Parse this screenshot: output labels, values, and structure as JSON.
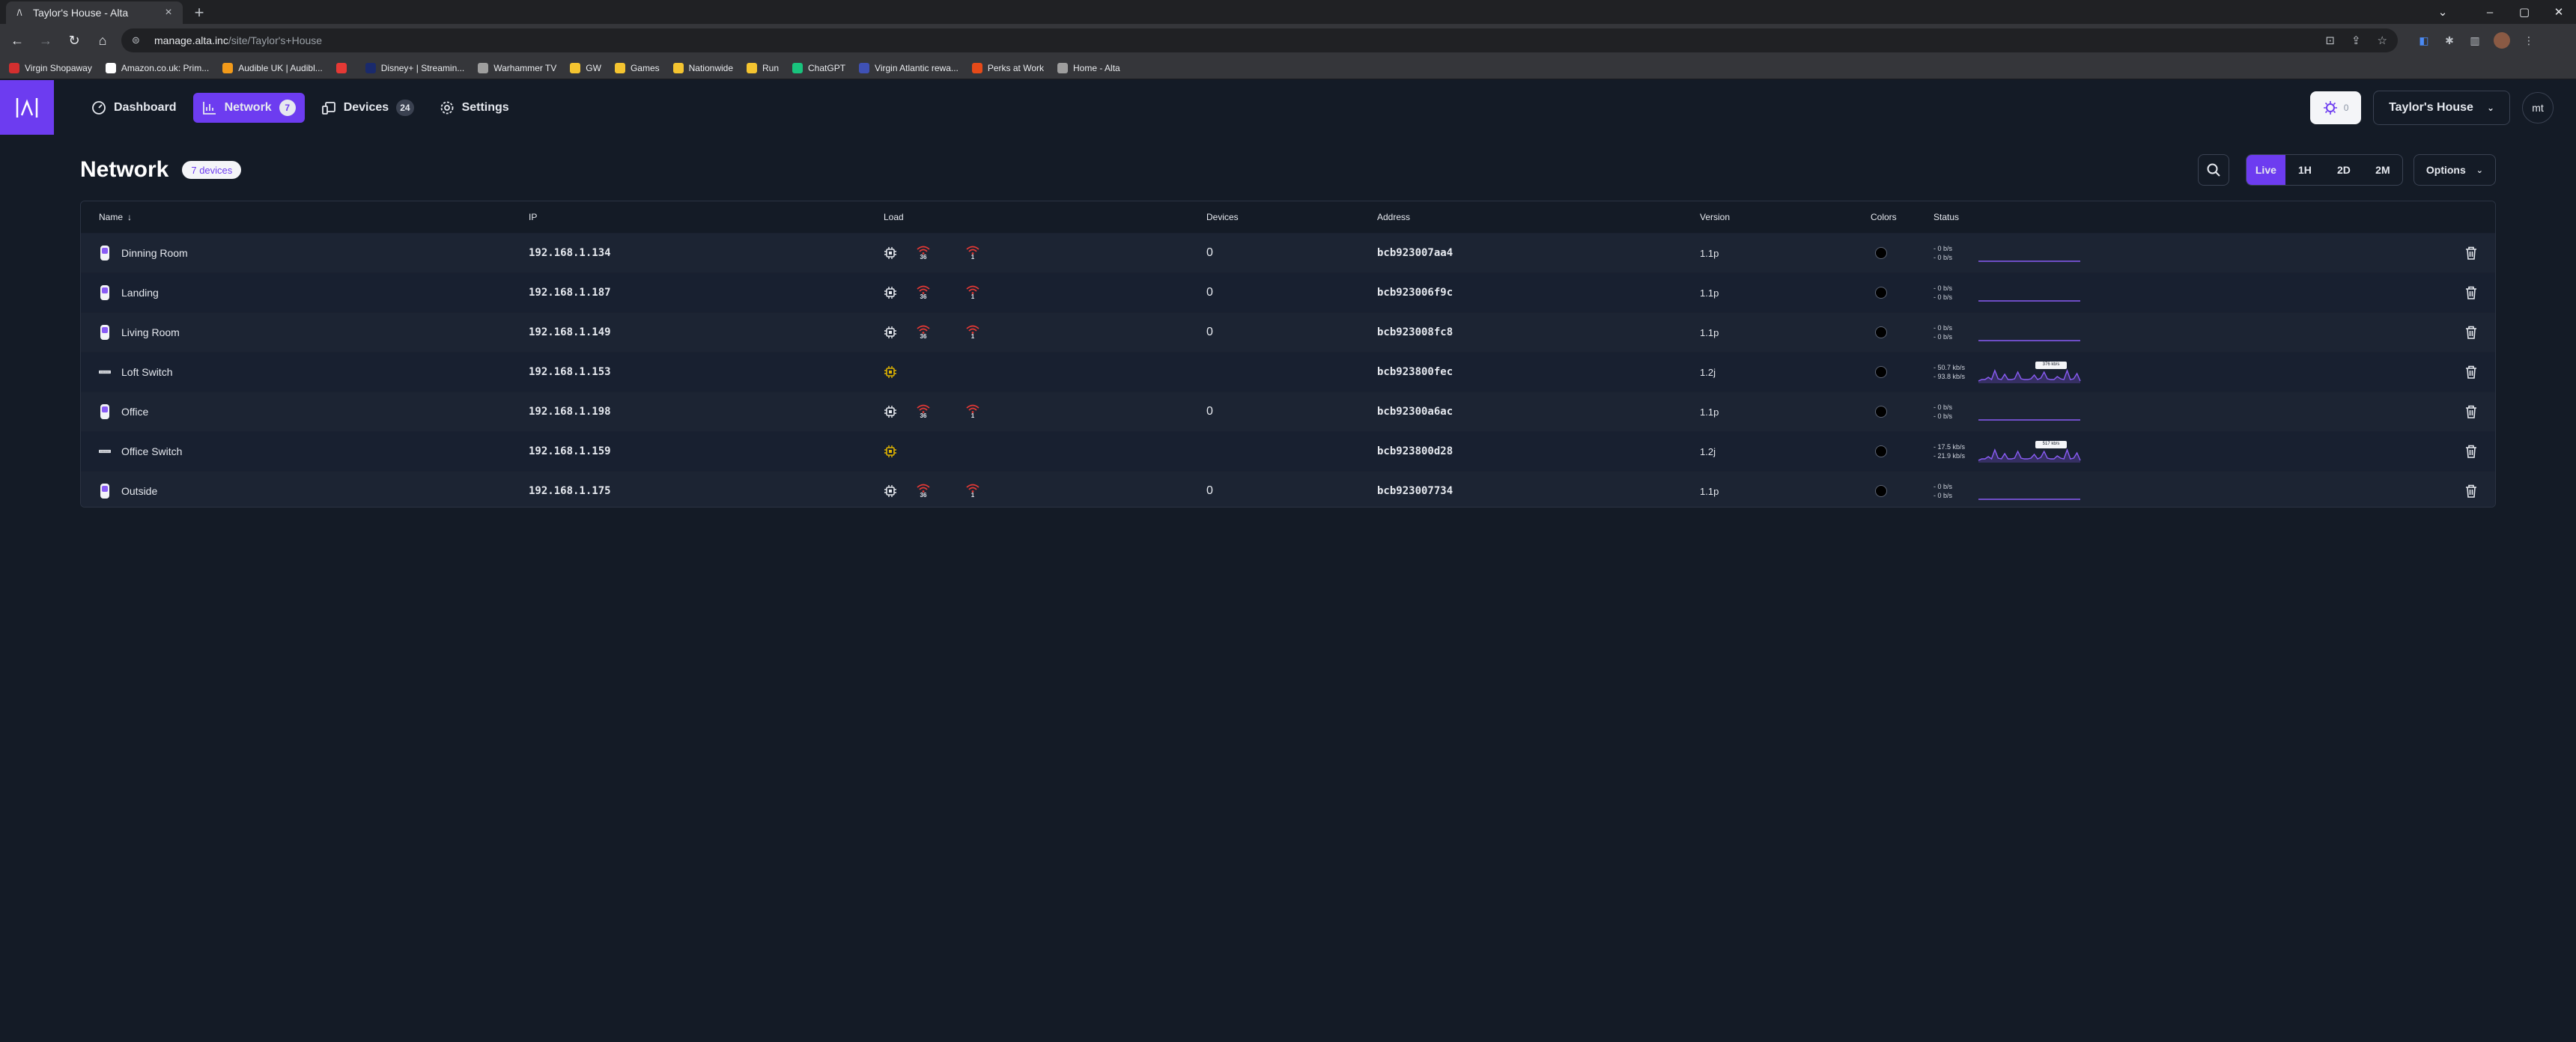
{
  "browser": {
    "tab_title": "Taylor's House - Alta",
    "url_host": "manage.alta.inc",
    "url_path": "/site/Taylor's+House",
    "bookmarks": [
      {
        "label": "Virgin Shopaway",
        "color": "#d32f2f"
      },
      {
        "label": "Amazon.co.uk: Prim...",
        "color": "#ffffff"
      },
      {
        "label": "Audible UK | Audibl...",
        "color": "#f29a1a"
      },
      {
        "label": "",
        "color": "#e53935"
      },
      {
        "label": "Disney+ | Streamin...",
        "color": "#1a2a6c"
      },
      {
        "label": "Warhammer TV",
        "color": "#9e9e9e"
      },
      {
        "label": "GW",
        "color": "#f4c430"
      },
      {
        "label": "Games",
        "color": "#f4c430"
      },
      {
        "label": "Nationwide",
        "color": "#f4c430"
      },
      {
        "label": "Run",
        "color": "#f4c430"
      },
      {
        "label": "ChatGPT",
        "color": "#19c37d"
      },
      {
        "label": "Virgin Atlantic rewa...",
        "color": "#3f51b5"
      },
      {
        "label": "Perks at Work",
        "color": "#e64a19"
      },
      {
        "label": "Home - Alta",
        "color": "#9e9e9e"
      }
    ]
  },
  "nav": {
    "items": [
      {
        "label": "Dashboard",
        "icon": "gauge-icon",
        "badge": ""
      },
      {
        "label": "Network",
        "icon": "chart-icon",
        "badge": "7"
      },
      {
        "label": "Devices",
        "icon": "devices-icon",
        "badge": "24"
      },
      {
        "label": "Settings",
        "icon": "gear-icon",
        "badge": ""
      }
    ],
    "alerts_count": "0",
    "site_name": "Taylor's House",
    "user_initials": "mt"
  },
  "page": {
    "title": "Network",
    "count_label": "7 devices",
    "ranges": [
      "Live",
      "1H",
      "2D",
      "2M"
    ],
    "active_range": "Live",
    "options_label": "Options"
  },
  "table": {
    "headers": {
      "name": "Name",
      "ip": "IP",
      "load": "Load",
      "devices": "Devices",
      "address": "Address",
      "version": "Version",
      "colors": "Colors",
      "status": "Status"
    },
    "rows": [
      {
        "name": "Dinning Room",
        "kind": "ap",
        "ip": "192.168.1.134",
        "wifi_a": "36",
        "wifi_b": "1",
        "devices": "0",
        "address": "bcb923007aa4",
        "version": "1.1p",
        "rate_up": "- 0 b/s",
        "rate_down": "- 0 b/s",
        "tag": ""
      },
      {
        "name": "Landing",
        "kind": "ap",
        "ip": "192.168.1.187",
        "wifi_a": "36",
        "wifi_b": "1",
        "devices": "0",
        "address": "bcb923006f9c",
        "version": "1.1p",
        "rate_up": "- 0 b/s",
        "rate_down": "- 0 b/s",
        "tag": ""
      },
      {
        "name": "Living Room",
        "kind": "ap",
        "ip": "192.168.1.149",
        "wifi_a": "36",
        "wifi_b": "1",
        "devices": "0",
        "address": "bcb923008fc8",
        "version": "1.1p",
        "rate_up": "- 0 b/s",
        "rate_down": "- 0 b/s",
        "tag": ""
      },
      {
        "name": "Loft Switch",
        "kind": "switch",
        "ip": "192.168.1.153",
        "wifi_a": "",
        "wifi_b": "",
        "devices": "",
        "address": "bcb923800fec",
        "version": "1.2j",
        "rate_up": "- 50.7 kb/s",
        "rate_down": "- 93.8 kb/s",
        "tag": "376 kb/s"
      },
      {
        "name": "Office",
        "kind": "ap",
        "ip": "192.168.1.198",
        "wifi_a": "36",
        "wifi_b": "1",
        "devices": "0",
        "address": "bcb92300a6ac",
        "version": "1.1p",
        "rate_up": "- 0 b/s",
        "rate_down": "- 0 b/s",
        "tag": ""
      },
      {
        "name": "Office Switch",
        "kind": "switch",
        "ip": "192.168.1.159",
        "wifi_a": "",
        "wifi_b": "",
        "devices": "",
        "address": "bcb923800d28",
        "version": "1.2j",
        "rate_up": "- 17.5 kb/s",
        "rate_down": "- 21.9 kb/s",
        "tag": "517 kb/s"
      },
      {
        "name": "Outside",
        "kind": "ap",
        "ip": "192.168.1.175",
        "wifi_a": "36",
        "wifi_b": "1",
        "devices": "0",
        "address": "bcb923007734",
        "version": "1.1p",
        "rate_up": "- 0 b/s",
        "rate_down": "- 0 b/s",
        "tag": ""
      }
    ]
  },
  "colors": {
    "accent": "#6d3cf0",
    "background": "#141b26",
    "wifi_red": "#e53935",
    "load_warn": "#e0b400",
    "spark": "#8a5cf6"
  }
}
